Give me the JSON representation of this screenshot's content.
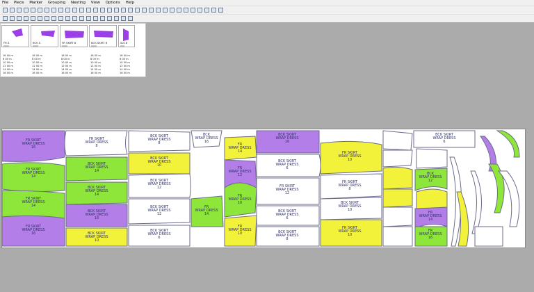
{
  "menu": [
    "File",
    "Piece",
    "Marker",
    "Grouping",
    "Nesting",
    "View",
    "Options",
    "Help"
  ],
  "toolbar1": [
    "back",
    "step",
    "new",
    "open",
    "save",
    "print",
    "preview",
    "cut",
    "copy",
    "paste",
    "undo",
    "redo",
    "grid",
    "list",
    "measure",
    "calc",
    "zoom",
    "fit",
    "zoomin",
    "zoomout",
    "rotate",
    "flip",
    "group",
    "ungroup",
    "tile",
    "align",
    "split",
    "merge",
    "color",
    "layer",
    "props",
    "help"
  ],
  "toolbar2": [
    "first",
    "prev",
    "play",
    "next",
    "last",
    "lock",
    "unlock",
    "cut2",
    "copy2",
    "trim",
    "buffer",
    "notch",
    "add",
    "remove",
    "reset",
    "run",
    "config",
    "layers",
    "view"
  ],
  "pieces": [
    {
      "name": "FR S",
      "code": "||||||||",
      "color": "#9b3fe8",
      "qty": [
        "16 00 m",
        "8 00 m",
        "10 00 m",
        "12 00 m",
        "14 00 m",
        "16 00 m"
      ]
    },
    {
      "name": "BCK S",
      "code": "||||||||",
      "color": "#9b3fe8",
      "qty": [
        "16 00 m",
        "8 00 m",
        "10 00 m",
        "12 00 m",
        "14 00 m",
        "16 00 m"
      ]
    },
    {
      "name": "FR SKIRT 8",
      "code": "||||||||",
      "color": "#9b3fe8",
      "qty": [
        "16 00 m",
        "8 00 m",
        "10 00 m",
        "12 00 m",
        "14 00 m",
        "16 00 m"
      ]
    },
    {
      "name": "BCK SKIRT 8",
      "code": "||||||||",
      "color": "#9b3fe8",
      "qty": [
        "16 00 m",
        "8 00 m",
        "10 00 m",
        "12 00 m",
        "14 00 m",
        "16 00 m"
      ]
    },
    {
      "name": "SLV 8",
      "code": "||||||",
      "color": "#9b3fe8",
      "qty": [
        "16 00 m",
        "8 00 m",
        "10 00 m",
        "12 00 m",
        "14 00 m",
        "16 00 m"
      ]
    }
  ],
  "colors": {
    "purple": "#b37ee8",
    "green": "#8ee63a",
    "yellow": "#f2f23a",
    "white": "#ffffff"
  },
  "marker_labels": [
    [
      "FR SKIRT",
      "WRAP DRESS",
      "16"
    ],
    [
      "FR SKIRT",
      "WRAP DRESS",
      "14"
    ],
    [
      "FR SKIRT",
      "WRAP DRESS",
      "14"
    ],
    [
      "FR SKIRT",
      "WRAP DRESS",
      "16"
    ],
    [
      "FR SKIRT",
      "WRAP DRESS",
      "8"
    ],
    [
      "BCK SKIRT",
      "WRAP DRESS",
      "14"
    ],
    [
      "BCK SKIRT",
      "WRAP DRESS",
      "14"
    ],
    [
      "BCK SKIRT",
      "WRAP DRESS",
      "16"
    ],
    [
      "BCK SKIRT",
      "WRAP DRESS",
      "10"
    ],
    [
      "BCK SKIRT",
      "WRAP DRESS",
      "8"
    ],
    [
      "BCK SKIRT",
      "WRAP DRESS",
      "10"
    ],
    [
      "BCK SKIRT",
      "WRAP DRESS",
      "12"
    ],
    [
      "BCK SKIRT",
      "WRAP DRESS",
      "12"
    ],
    [
      "BCK SKIRT",
      "WRAP DRESS",
      "6"
    ],
    [
      "BCK",
      "WRAP DRESS",
      "16"
    ],
    [
      "FR",
      "WRAP DRESS",
      "12"
    ],
    [
      "FR",
      "WRAP DRESS",
      "14"
    ],
    [
      "FR",
      "WRAP DRESS",
      "10"
    ],
    [
      "FR",
      "WRAP DRESS",
      "14"
    ],
    [
      "FR",
      "WRAP DRESS",
      "10"
    ],
    [
      "BCK SKIRT",
      "WRAP DRESS",
      "16"
    ],
    [
      "BCK SKIRT",
      "WRAP DRESS",
      "6"
    ],
    [
      "FR SKIRT",
      "WRAP DRESS",
      "12"
    ],
    [
      "BCK SKIRT",
      "WRAP DRESS",
      "6"
    ],
    [
      "BCK SKIRT",
      "WRAP DRESS",
      "8"
    ],
    [
      "FR SKIRT",
      "WRAP DRESS",
      "10"
    ],
    [
      "FR SKIRT",
      "WRAP DRESS",
      "8"
    ],
    [
      "BCK SKIRT",
      "WRAP DRESS",
      "10"
    ],
    [
      "FR SKIRT",
      "WRAP DRESS",
      "10"
    ],
    [
      "BCK SKIRT",
      "WRAP DRESS",
      "6"
    ],
    [
      "BCK",
      "WRAP DRESS",
      "12"
    ],
    [
      "FR",
      "WRAP DRESS",
      "14"
    ],
    [
      "FR",
      "WRAP DRESS",
      "16"
    ]
  ]
}
